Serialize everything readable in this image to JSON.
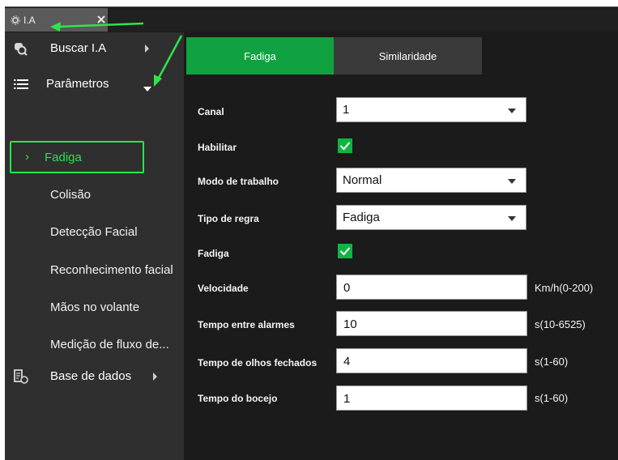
{
  "window": {
    "tab_title": "I.A",
    "close_icon": "close-icon",
    "gear_icon": "gear-icon"
  },
  "sidebar": {
    "buscar": {
      "label": "Buscar I.A",
      "icon": "search-robot-icon"
    },
    "parametros": {
      "label": "Parâmetros",
      "icon": "list-icon"
    },
    "sub_items": [
      {
        "label": "Fadiga",
        "active": true
      },
      {
        "label": "Colisão"
      },
      {
        "label": "Detecção Facial"
      },
      {
        "label": "Reconhecimento facial"
      },
      {
        "label": "Mãos no volante"
      },
      {
        "label": "Medição de fluxo de..."
      }
    ],
    "base": {
      "label": "Base de dados",
      "icon": "database-icon"
    },
    "active_color": "#2fe04e"
  },
  "main": {
    "tabs": [
      {
        "label": "Fadiga",
        "active": true
      },
      {
        "label": "Similaridade",
        "active": false
      }
    ],
    "form": {
      "canal": {
        "label": "Canal",
        "value": "1"
      },
      "habilitar": {
        "label": "Habilitar",
        "checked": true
      },
      "modo": {
        "label": "Modo de trabalho",
        "value": "Normal"
      },
      "tipo": {
        "label": "Tipo de regra",
        "value": "Fadiga"
      },
      "fadiga": {
        "label": "Fadiga",
        "checked": true
      },
      "velocidade": {
        "label": "Velocidade",
        "value": "0",
        "unit": "Km/h(0-200)"
      },
      "tempo_alarmes": {
        "label": "Tempo entre alarmes",
        "value": "10",
        "unit": "s(10-6525)"
      },
      "tempo_olhos": {
        "label": "Tempo de olhos fechados",
        "value": "4",
        "unit": "s(1-60)"
      },
      "tempo_bocejo": {
        "label": "Tempo do bocejo",
        "value": "1",
        "unit": "s(1-60)"
      }
    },
    "accent_color": "#10a240"
  }
}
